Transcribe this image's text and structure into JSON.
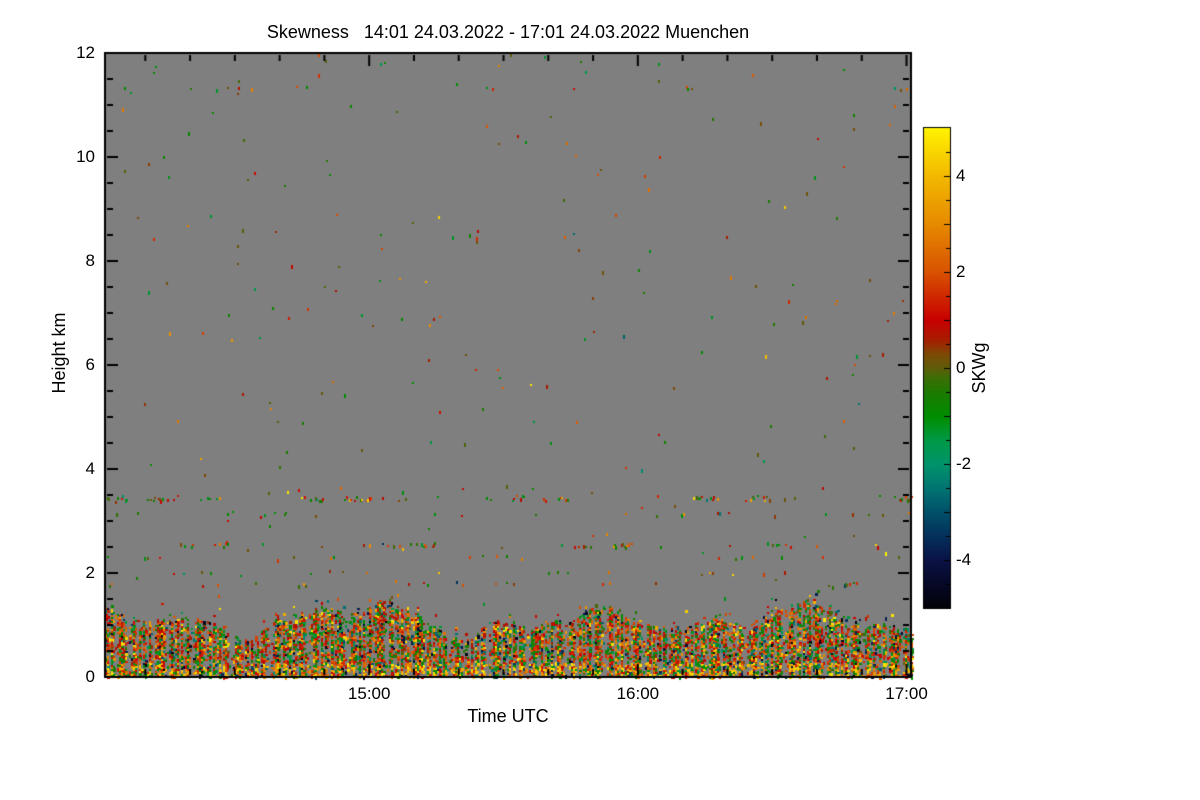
{
  "chart_data": {
    "type": "heatmap",
    "title": "Skewness   14:01 24.03.2022 - 17:01 24.03.2022 Muenchen",
    "xlabel": "Time UTC",
    "ylabel": "Height km",
    "site": "Muenchen",
    "time_start": "14:01 24.03.2022",
    "time_end": "17:01 24.03.2022",
    "x_ticks": [
      "15:00",
      "16:00",
      "17:00"
    ],
    "x_tick_minutes": [
      59,
      119,
      179
    ],
    "x_total_minutes": 180,
    "x_minor_interval_min": 10,
    "ylim": [
      0,
      12
    ],
    "y_ticks": [
      0,
      2,
      4,
      6,
      8,
      10,
      12
    ],
    "y_minor_interval_km": 0.5,
    "plot_bg_color": "#7f7f7f",
    "frame_color": "#000000",
    "colorbar": {
      "label": "SKWg",
      "min": -5,
      "max": 5,
      "ticks": [
        4,
        2,
        0,
        -2,
        -4
      ],
      "minor_interval": 0.5,
      "stops": [
        [
          -5.0,
          "#020208"
        ],
        [
          -4.5,
          "#060826"
        ],
        [
          -4.0,
          "#0a1246"
        ],
        [
          -3.5,
          "#04305c"
        ],
        [
          -3.0,
          "#005068"
        ],
        [
          -2.5,
          "#007472"
        ],
        [
          -2.0,
          "#00936b"
        ],
        [
          -1.5,
          "#009946"
        ],
        [
          -1.0,
          "#008e00"
        ],
        [
          -0.5,
          "#1c7a00"
        ],
        [
          -0.2,
          "#3c6e06"
        ],
        [
          0.0,
          "#5e5e0a"
        ],
        [
          0.3,
          "#7e4a06"
        ],
        [
          0.6,
          "#a81c00"
        ],
        [
          1.0,
          "#c80000"
        ],
        [
          1.5,
          "#d02800"
        ],
        [
          2.0,
          "#d85200"
        ],
        [
          3.0,
          "#e68a00"
        ],
        [
          4.0,
          "#f2b800"
        ],
        [
          5.0,
          "#fff200"
        ]
      ]
    },
    "features": {
      "description": "Doppler-lidar skewness time-height plot: dense speckled convective boundary layer below ~1.5 km with plume-shaped tops, thin speckled aerosol layers near 2.0, 2.3, 2.55, 3.15, 3.45 and 11.35 km, sparse random speckles in the gray free troposphere.",
      "seed": 1337,
      "sparse_count": 230,
      "boundary_layer": {
        "top_km_base": 1.14,
        "top_km_waves": [
          [
            0.2,
            36.0,
            0.8
          ],
          [
            0.13,
            16.2,
            2.3
          ],
          [
            0.09,
            63.0,
            4.0
          ],
          [
            0.05,
            8.7,
            1.1
          ]
        ],
        "fill_density": 0.72,
        "top_zone_density": 0.45,
        "ground_density": 0.82,
        "ground_top_km": 0.28,
        "above_decay_km": 0.1,
        "above_base_density": 0.1,
        "above_max_km": 0.46
      },
      "aerosol_bands": [
        {
          "km": 11.35,
          "thick": 0.06,
          "density": 0.015,
          "phase": 1.2
        },
        {
          "km": 3.45,
          "thick": 0.1,
          "density": 0.16,
          "phase": 0.3
        },
        {
          "km": 3.15,
          "thick": 0.06,
          "density": 0.04,
          "phase": 2.0
        },
        {
          "km": 2.55,
          "thick": 0.08,
          "density": 0.1,
          "phase": 4.1
        },
        {
          "km": 2.32,
          "thick": 0.05,
          "density": 0.03,
          "phase": 1.0
        },
        {
          "km": 2.02,
          "thick": 0.06,
          "density": 0.035,
          "phase": 5.2
        },
        {
          "km": 1.8,
          "thick": 0.09,
          "density": 0.05,
          "phase": 2.6
        }
      ],
      "palettes": {
        "bl": [
          [
            0.4,
            0.5,
            2.2
          ],
          [
            0.27,
            -1.6,
            -0.3
          ],
          [
            0.1,
            2.2,
            3.4
          ],
          [
            0.08,
            3.4,
            5.0
          ],
          [
            0.06,
            -3.2,
            -1.8
          ],
          [
            0.05,
            -5.0,
            -3.4
          ],
          [
            0.04,
            -0.3,
            0.5
          ]
        ],
        "ground": [
          [
            0.3,
            2.5,
            5.0
          ],
          [
            0.3,
            0.8,
            2.5
          ],
          [
            0.2,
            -1.5,
            -0.3
          ],
          [
            0.1,
            3.8,
            5.0
          ],
          [
            0.1,
            -5.0,
            -2.0
          ]
        ],
        "sparse": [
          [
            0.28,
            -0.2,
            0.5
          ],
          [
            0.27,
            -1.6,
            -0.4
          ],
          [
            0.25,
            1.4,
            3.2
          ],
          [
            0.12,
            0.5,
            1.4
          ],
          [
            0.05,
            3.4,
            5.0
          ],
          [
            0.03,
            -3.5,
            -1.5
          ]
        ],
        "band": [
          [
            0.3,
            -1.4,
            -0.3
          ],
          [
            0.3,
            0.6,
            2.2
          ],
          [
            0.2,
            -0.3,
            0.6
          ],
          [
            0.12,
            2.2,
            3.6
          ],
          [
            0.05,
            3.6,
            5.0
          ],
          [
            0.03,
            -3.5,
            -1.5
          ]
        ]
      }
    }
  }
}
